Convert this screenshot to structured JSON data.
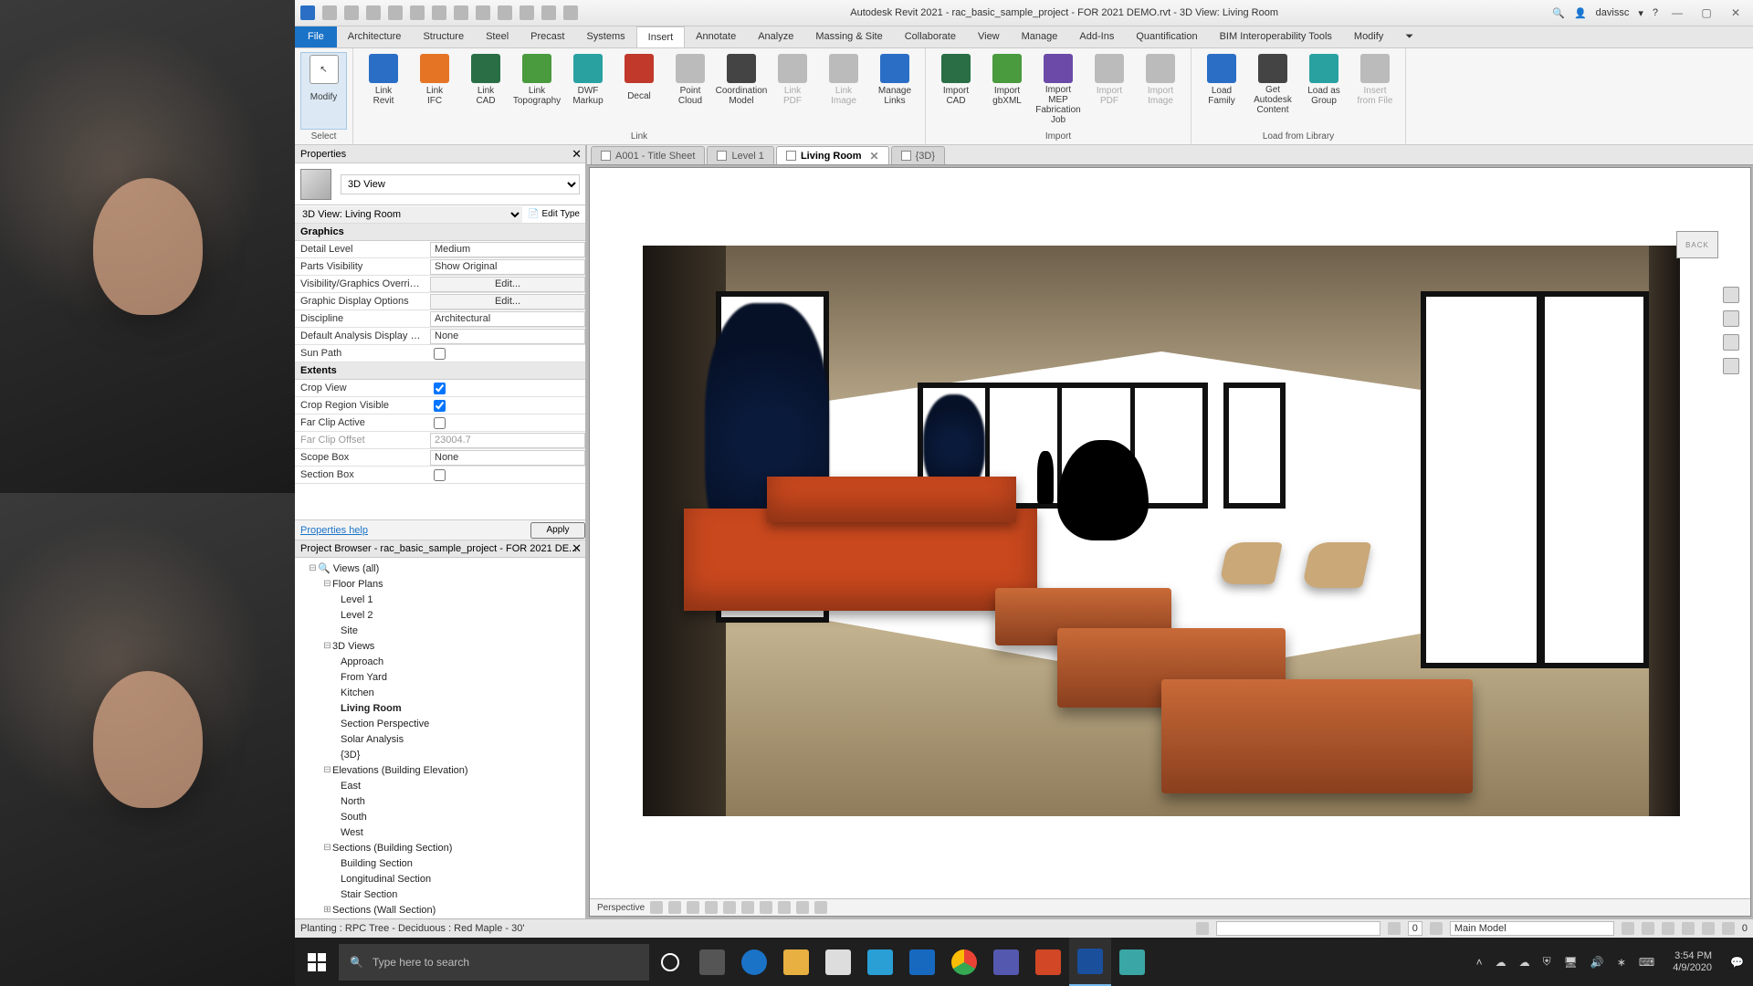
{
  "titlebar": {
    "title": "Autodesk Revit 2021 - rac_basic_sample_project - FOR 2021 DEMO.rvt - 3D View: Living Room",
    "user": "davissc"
  },
  "ribbon": {
    "tabs": [
      "File",
      "Architecture",
      "Structure",
      "Steel",
      "Precast",
      "Systems",
      "Insert",
      "Annotate",
      "Analyze",
      "Massing & Site",
      "Collaborate",
      "View",
      "Manage",
      "Add-Ins",
      "Quantification",
      "BIM Interoperability Tools",
      "Modify"
    ],
    "active_tab": "Insert",
    "select_label": "Select",
    "modify_label": "Modify",
    "groups": [
      {
        "title": "Link",
        "items": [
          {
            "label": "Link\nRevit",
            "cls": "ic-blue"
          },
          {
            "label": "Link\nIFC",
            "cls": "ic-orange"
          },
          {
            "label": "Link\nCAD",
            "cls": "ic-cad"
          },
          {
            "label": "Link\nTopography",
            "cls": "ic-green"
          },
          {
            "label": "DWF\nMarkup",
            "cls": "ic-teal"
          },
          {
            "label": "Decal",
            "cls": "ic-red"
          },
          {
            "label": "Point\nCloud",
            "cls": "ic-grey"
          },
          {
            "label": "Coordination\nModel",
            "cls": "ic-dark"
          },
          {
            "label": "Link\nPDF",
            "cls": "ic-grey",
            "disabled": true
          },
          {
            "label": "Link\nImage",
            "cls": "ic-grey",
            "disabled": true
          },
          {
            "label": "Manage\nLinks",
            "cls": "ic-blue"
          }
        ]
      },
      {
        "title": "Import",
        "items": [
          {
            "label": "Import\nCAD",
            "cls": "ic-cad"
          },
          {
            "label": "Import\ngbXML",
            "cls": "ic-green"
          },
          {
            "label": "Import MEP\nFabrication Job",
            "cls": "ic-purple"
          },
          {
            "label": "Import\nPDF",
            "cls": "ic-grey",
            "disabled": true
          },
          {
            "label": "Import\nImage",
            "cls": "ic-grey",
            "disabled": true
          }
        ]
      },
      {
        "title": "Load from Library",
        "items": [
          {
            "label": "Load\nFamily",
            "cls": "ic-blue"
          },
          {
            "label": "Get Autodesk\nContent",
            "cls": "ic-dark"
          },
          {
            "label": "Load as\nGroup",
            "cls": "ic-teal"
          },
          {
            "label": "Insert\nfrom File",
            "cls": "ic-grey",
            "disabled": true
          }
        ]
      }
    ]
  },
  "properties": {
    "panel_title": "Properties",
    "type_selector": "3D View",
    "instance": "3D View: Living Room",
    "edit_type": "Edit Type",
    "help": "Properties help",
    "apply": "Apply",
    "cats": [
      {
        "name": "Graphics",
        "rows": [
          {
            "n": "Detail Level",
            "v": "Medium",
            "t": "text"
          },
          {
            "n": "Parts Visibility",
            "v": "Show Original",
            "t": "text"
          },
          {
            "n": "Visibility/Graphics Overrides",
            "v": "Edit...",
            "t": "btn"
          },
          {
            "n": "Graphic Display Options",
            "v": "Edit...",
            "t": "btn"
          },
          {
            "n": "Discipline",
            "v": "Architectural",
            "t": "text"
          },
          {
            "n": "Default Analysis Display St...",
            "v": "None",
            "t": "text"
          },
          {
            "n": "Sun Path",
            "v": "",
            "t": "check",
            "checked": false
          }
        ]
      },
      {
        "name": "Extents",
        "rows": [
          {
            "n": "Crop View",
            "v": "",
            "t": "check",
            "checked": true
          },
          {
            "n": "Crop Region Visible",
            "v": "",
            "t": "check",
            "checked": true
          },
          {
            "n": "Far Clip Active",
            "v": "",
            "t": "check",
            "checked": false
          },
          {
            "n": "Far Clip Offset",
            "v": "23004.7",
            "t": "text",
            "dim": true
          },
          {
            "n": "Scope Box",
            "v": "None",
            "t": "text"
          },
          {
            "n": "Section Box",
            "v": "",
            "t": "check",
            "checked": false
          }
        ]
      }
    ]
  },
  "browser": {
    "title": "Project Browser - rac_basic_sample_project - FOR 2021 DE...",
    "root": "Views (all)",
    "tree": [
      {
        "label": "Floor Plans",
        "children": [
          "Level 1",
          "Level 2",
          "Site"
        ]
      },
      {
        "label": "3D Views",
        "children": [
          "Approach",
          "From Yard",
          "Kitchen",
          "Living Room",
          "Section Perspective",
          "Solar Analysis",
          "{3D}"
        ],
        "active": "Living Room"
      },
      {
        "label": "Elevations (Building Elevation)",
        "children": [
          "East",
          "North",
          "South",
          "West"
        ]
      },
      {
        "label": "Sections (Building Section)",
        "children": [
          "Building Section",
          "Longitudinal Section",
          "Stair Section"
        ]
      },
      {
        "label": "Sections (Wall Section)",
        "children": []
      }
    ]
  },
  "viewtabs": [
    {
      "label": "A001 - Title Sheet"
    },
    {
      "label": "Level 1"
    },
    {
      "label": "Living Room",
      "active": true,
      "closable": true
    },
    {
      "label": "{3D}"
    }
  ],
  "viewcube": {
    "face": "BACK"
  },
  "viewcontrol": {
    "scale": "Perspective"
  },
  "statusbar": {
    "hint": "Planting : RPC Tree - Deciduous : Red Maple - 30'",
    "workset_num": "0",
    "main_model": "Main Model",
    "filter_count": "0"
  },
  "taskbar": {
    "search_placeholder": "Type here to search",
    "clock_time": "3:54 PM",
    "clock_date": "4/9/2020"
  }
}
